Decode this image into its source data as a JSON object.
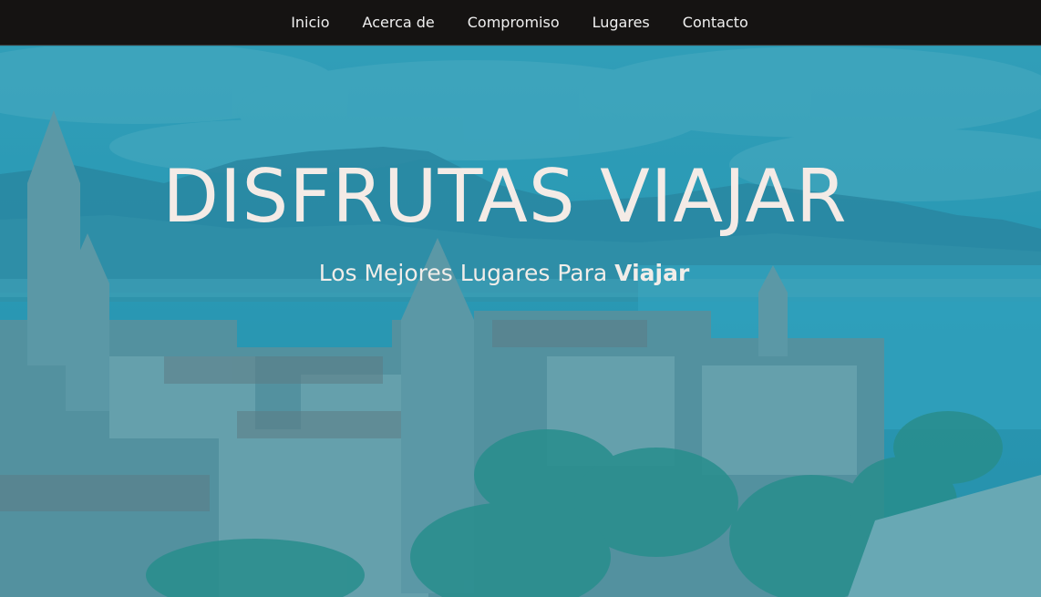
{
  "nav": {
    "items": [
      {
        "label": "Inicio"
      },
      {
        "label": "Acerca de"
      },
      {
        "label": "Compromiso"
      },
      {
        "label": "Lugares"
      },
      {
        "label": "Contacto"
      }
    ]
  },
  "hero": {
    "title": "DISFRUTAS VIAJAR",
    "subtitle_prefix": "Los Mejores Lugares Para ",
    "subtitle_emphasis": "Viajar"
  },
  "colors": {
    "navbar_bg": "#151312",
    "overlay_tint": "#2096b4",
    "hero_text": "#f4ebe6"
  }
}
